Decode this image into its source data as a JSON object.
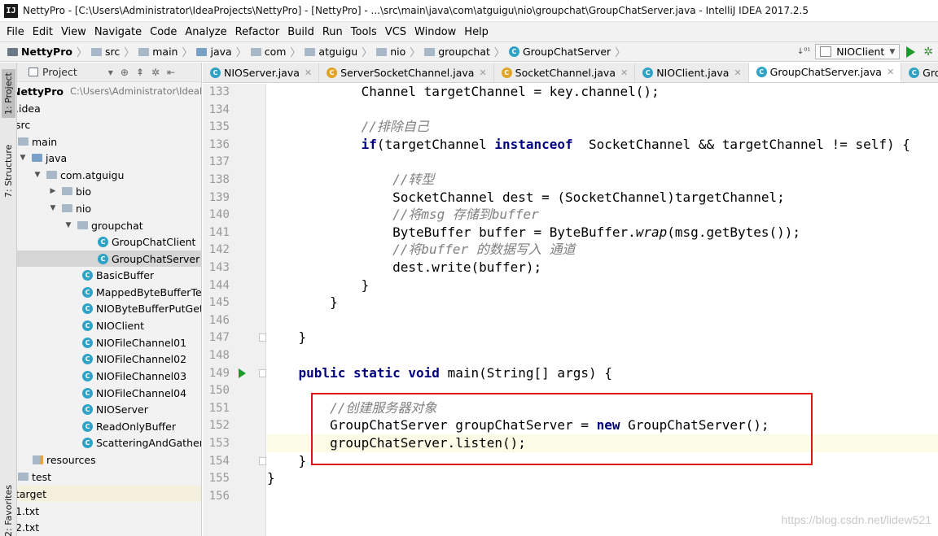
{
  "window": {
    "title": "NettyPro - [C:\\Users\\Administrator\\IdeaProjects\\NettyPro] - [NettyPro] - ...\\src\\main\\java\\com\\atguigu\\nio\\groupchat\\GroupChatServer.java - IntelliJ IDEA 2017.2.5",
    "app_icon": "IJ"
  },
  "menu": [
    "File",
    "Edit",
    "View",
    "Navigate",
    "Code",
    "Analyze",
    "Refactor",
    "Build",
    "Run",
    "Tools",
    "VCS",
    "Window",
    "Help"
  ],
  "breadcrumbs": [
    "NettyPro",
    "src",
    "main",
    "java",
    "com",
    "atguigu",
    "nio",
    "groupchat",
    "GroupChatServer"
  ],
  "run_config": "NIOClient",
  "tool_windows": {
    "project_tab": "1: Project",
    "structure_tab": "7: Structure",
    "favorites_tab": "2: Favorites"
  },
  "project_panel": {
    "header": "Project",
    "root_path": "C:\\Users\\Administrator\\IdeaProje",
    "tree": [
      {
        "label": "NettyPro",
        "bold": true
      },
      {
        "label": ".idea"
      },
      {
        "label": "src"
      },
      {
        "label": "main"
      },
      {
        "label": "java"
      },
      {
        "label": "com.atguigu"
      },
      {
        "label": "bio"
      },
      {
        "label": "nio"
      },
      {
        "label": "groupchat"
      },
      {
        "label": "GroupChatClient"
      },
      {
        "label": "GroupChatServer",
        "selected": true
      },
      {
        "label": "BasicBuffer"
      },
      {
        "label": "MappedByteBufferTest"
      },
      {
        "label": "NIOByteBufferPutGet"
      },
      {
        "label": "NIOClient"
      },
      {
        "label": "NIOFileChannel01"
      },
      {
        "label": "NIOFileChannel02"
      },
      {
        "label": "NIOFileChannel03"
      },
      {
        "label": "NIOFileChannel04"
      },
      {
        "label": "NIOServer"
      },
      {
        "label": "ReadOnlyBuffer"
      },
      {
        "label": "ScatteringAndGatheringTest"
      },
      {
        "label": "resources"
      },
      {
        "label": "test"
      },
      {
        "label": "target"
      },
      {
        "label": "1.txt"
      },
      {
        "label": "2.txt"
      }
    ]
  },
  "editor_tabs": [
    {
      "label": "NIOServer.java"
    },
    {
      "label": "ServerSocketChannel.java"
    },
    {
      "label": "SocketChannel.java"
    },
    {
      "label": "NIOClient.java"
    },
    {
      "label": "GroupChatServer.java",
      "active": true
    },
    {
      "label": "GroupChatClient.java"
    }
  ],
  "code": {
    "current_line": "153",
    "lines": [
      {
        "n": "133",
        "text": "            Channel targetChannel = key.channel();"
      },
      {
        "n": "134",
        "text": ""
      },
      {
        "n": "135",
        "text": "            //排除自己"
      },
      {
        "n": "136",
        "text": "            if(targetChannel instanceof  SocketChannel && targetChannel != self) {"
      },
      {
        "n": "137",
        "text": ""
      },
      {
        "n": "138",
        "text": "                //转型"
      },
      {
        "n": "139",
        "text": "                SocketChannel dest = (SocketChannel)targetChannel;"
      },
      {
        "n": "140",
        "text": "                //将msg 存储到buffer"
      },
      {
        "n": "141",
        "text": "                ByteBuffer buffer = ByteBuffer.wrap(msg.getBytes());"
      },
      {
        "n": "142",
        "text": "                //将buffer 的数据写入 通道"
      },
      {
        "n": "143",
        "text": "                dest.write(buffer);"
      },
      {
        "n": "144",
        "text": "            }"
      },
      {
        "n": "145",
        "text": "        }"
      },
      {
        "n": "146",
        "text": ""
      },
      {
        "n": "147",
        "text": "    }"
      },
      {
        "n": "148",
        "text": ""
      },
      {
        "n": "149",
        "text": "    public static void main(String[] args) {"
      },
      {
        "n": "150",
        "text": ""
      },
      {
        "n": "151",
        "text": "        //创建服务器对象"
      },
      {
        "n": "152",
        "text": "        GroupChatServer groupChatServer = new GroupChatServer();"
      },
      {
        "n": "153",
        "text": "        groupChatServer.listen();"
      },
      {
        "n": "154",
        "text": "    }"
      },
      {
        "n": "155",
        "text": "}"
      },
      {
        "n": "156",
        "text": ""
      }
    ]
  },
  "watermark": "https://blog.csdn.net/lidew521",
  "colors": {
    "keyword": "#000080",
    "comment": "#808080",
    "highlight_box": "#e11414",
    "run_green": "#1b9b2b",
    "class_icon": "#2fa3c6"
  }
}
